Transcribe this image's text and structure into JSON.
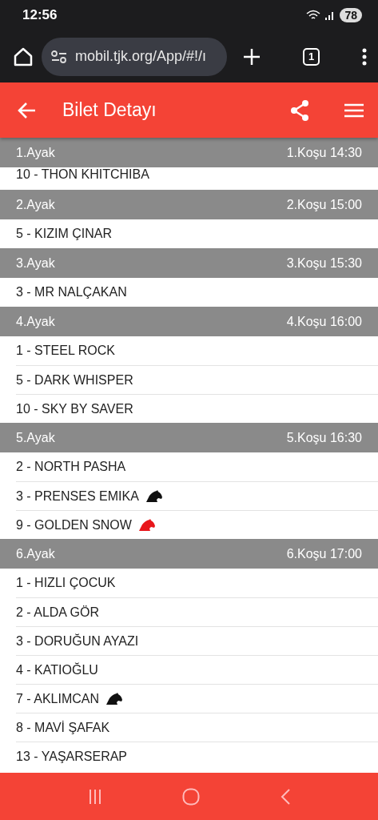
{
  "status_bar": {
    "time": "12:56",
    "battery": "78"
  },
  "browser": {
    "url": "mobil.tjk.org/App/#!/ı",
    "tab_count": "1"
  },
  "app_bar": {
    "title": "Bilet Detayı"
  },
  "legs": [
    {
      "leg": "1.Ayak",
      "race": "1.Koşu 14:30",
      "horses": [
        {
          "name": "10 - THON KHITCHIBA"
        }
      ]
    },
    {
      "leg": "2.Ayak",
      "race": "2.Koşu 15:00",
      "horses": [
        {
          "name": "5 - KIZIM ÇINAR"
        }
      ]
    },
    {
      "leg": "3.Ayak",
      "race": "3.Koşu 15:30",
      "horses": [
        {
          "name": "3 - MR NALÇAKAN"
        }
      ]
    },
    {
      "leg": "4.Ayak",
      "race": "4.Koşu 16:00",
      "horses": [
        {
          "name": "1 - STEEL ROCK"
        },
        {
          "name": "5 - DARK WHISPER"
        },
        {
          "name": "10 - SKY BY SAVER"
        }
      ]
    },
    {
      "leg": "5.Ayak",
      "race": "5.Koşu 16:30",
      "horses": [
        {
          "name": "2 - NORTH PASHA"
        },
        {
          "name": "3 - PRENSES EMIKA",
          "color": "#111111"
        },
        {
          "name": "9 - GOLDEN SNOW",
          "color": "#e8161b"
        }
      ]
    },
    {
      "leg": "6.Ayak",
      "race": "6.Koşu 17:00",
      "horses": [
        {
          "name": "1 - HIZLI ÇOCUK"
        },
        {
          "name": "2 - ALDA GÖR"
        },
        {
          "name": "3 - DORUĞUN AYAZI"
        },
        {
          "name": "4 - KATIOĞLU"
        },
        {
          "name": "7 - AKLIMCAN",
          "color": "#111111"
        },
        {
          "name": "8 - MAVİ ŞAFAK"
        },
        {
          "name": "13 - YAŞARSERAP"
        }
      ]
    }
  ]
}
